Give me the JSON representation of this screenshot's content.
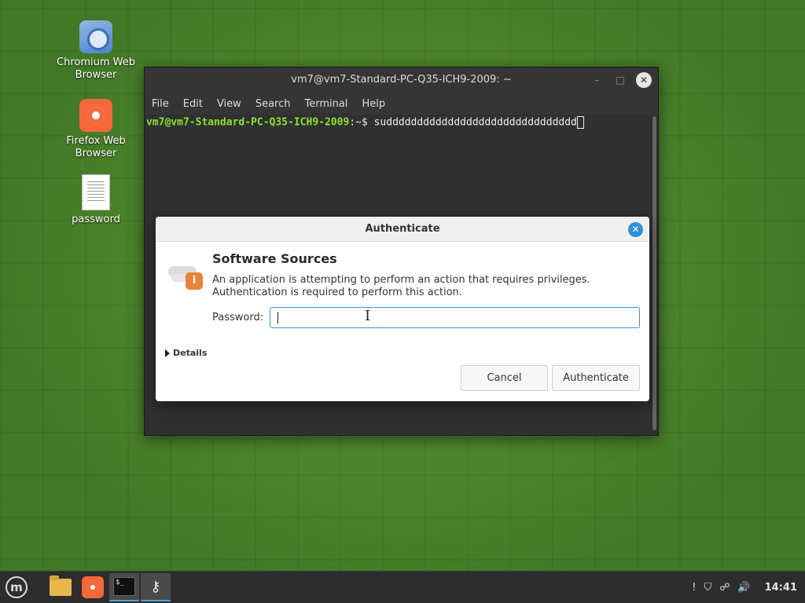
{
  "desktop": {
    "icons": [
      {
        "label": "Chromium Web Browser",
        "icon": "chromium-icon"
      },
      {
        "label": "Firefox Web Browser",
        "icon": "firefox-icon"
      },
      {
        "label": "password",
        "icon": "text-file-icon"
      }
    ]
  },
  "terminal": {
    "title": "vm7@vm7-Standard-PC-Q35-ICH9-2009: ~",
    "menu": [
      "File",
      "Edit",
      "View",
      "Search",
      "Terminal",
      "Help"
    ],
    "prompt_user": "vm7@vm7-Standard-PC-Q35-ICH9-2009",
    "prompt_suffix": ":~$ ",
    "command": "suddddddddddddddddddddddddddddddd",
    "minimize_glyph": "–",
    "maximize_glyph": "□",
    "close_glyph": "✕"
  },
  "dialog": {
    "title": "Authenticate",
    "heading": "Software Sources",
    "description": "An application is attempting to perform an action that requires privileges. Authentication is required to perform this action.",
    "password_label": "Password:",
    "password_value": "",
    "details_label": "Details",
    "cancel_label": "Cancel",
    "authenticate_label": "Authenticate",
    "close_glyph": "✕",
    "info_glyph": "i"
  },
  "taskbar": {
    "menu_glyph": "m",
    "terminal_glyph": "$_",
    "keys_glyph": "⚷",
    "clock": "14:41",
    "tray_icons": [
      "notification-icon",
      "shield-icon",
      "network-icon",
      "volume-icon"
    ],
    "tray_glyphs": [
      "!",
      "⛉",
      "☍",
      "🔊"
    ]
  },
  "colors": {
    "accent": "#3c8fd6",
    "prompt_green": "#8ae234",
    "desktop_green": "#4f8a2c"
  }
}
